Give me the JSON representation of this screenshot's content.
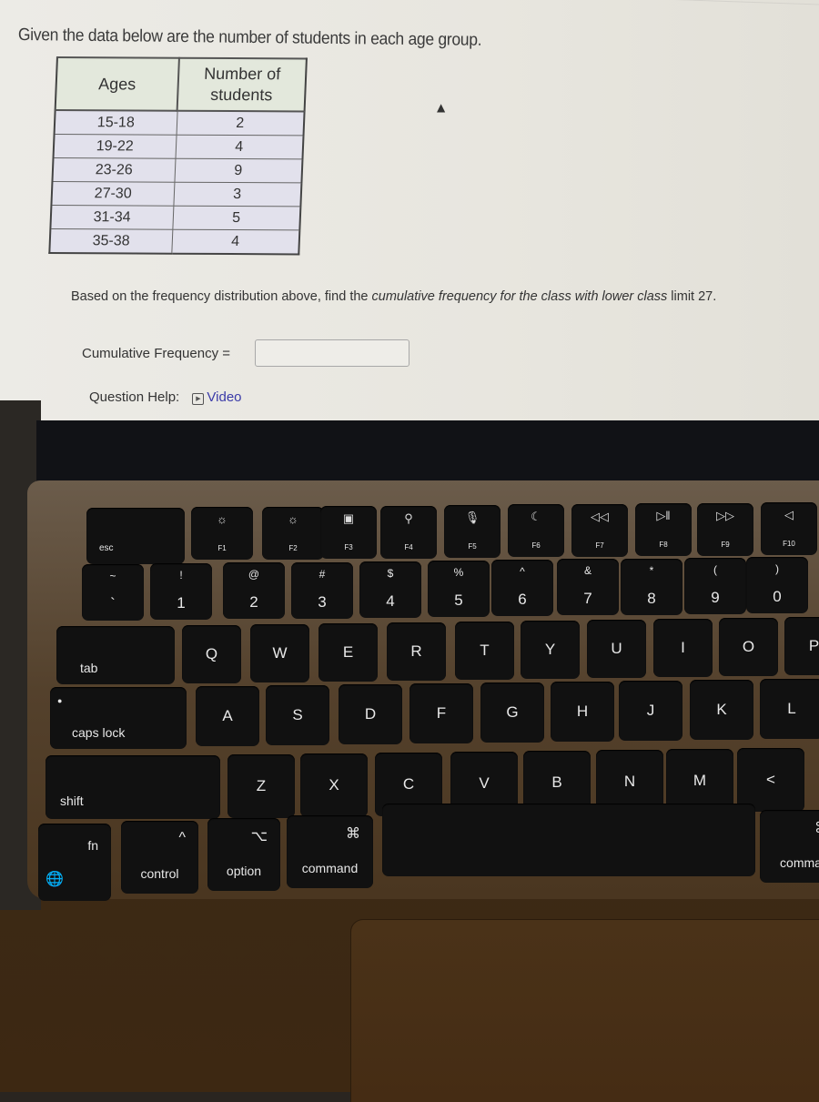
{
  "screen": {
    "title": "Given the data below are the number of students in each age group.",
    "table": {
      "headers": [
        "Ages",
        "Number of students"
      ],
      "rows": [
        {
          "ages": "15-18",
          "count": "2"
        },
        {
          "ages": "19-22",
          "count": "4"
        },
        {
          "ages": "23-26",
          "count": "9"
        },
        {
          "ages": "27-30",
          "count": "3"
        },
        {
          "ages": "31-34",
          "count": "5"
        },
        {
          "ages": "35-38",
          "count": "4"
        }
      ]
    },
    "question_pre": "Based on the frequency distribution above, find the ",
    "question_em": "cumulative frequency for the class with lower class",
    "question_post": " limit 27.",
    "answer_label": "Cumulative Frequency =",
    "answer_value": "",
    "help_label": "Question Help:",
    "help_link": "Video",
    "colors": {
      "link": "#3a3aa8",
      "table_header_bg": "#e3e8dc",
      "table_row_bg": "#e2e1ec"
    }
  },
  "keyboard": {
    "fn_row": [
      {
        "sym": "",
        "label": "esc"
      },
      {
        "sym": "☼",
        "label": "F1"
      },
      {
        "sym": "☼",
        "label": "F2"
      },
      {
        "sym": "▣",
        "label": "F3"
      },
      {
        "sym": "⚲",
        "label": "F4"
      },
      {
        "sym": "🎙",
        "label": "F5"
      },
      {
        "sym": "☾",
        "label": "F6"
      },
      {
        "sym": "◁◁",
        "label": "F7"
      },
      {
        "sym": "▷‖",
        "label": "F8"
      },
      {
        "sym": "▷▷",
        "label": "F9"
      },
      {
        "sym": "◁",
        "label": "F10"
      }
    ],
    "number_row": [
      {
        "top": "~",
        "bot": "`"
      },
      {
        "top": "!",
        "bot": "1"
      },
      {
        "top": "@",
        "bot": "2"
      },
      {
        "top": "#",
        "bot": "3"
      },
      {
        "top": "$",
        "bot": "4"
      },
      {
        "top": "%",
        "bot": "5"
      },
      {
        "top": "^",
        "bot": "6"
      },
      {
        "top": "&",
        "bot": "7"
      },
      {
        "top": "*",
        "bot": "8"
      },
      {
        "top": "(",
        "bot": "9"
      },
      {
        "top": ")",
        "bot": "0"
      }
    ],
    "qwerty_row": [
      "tab",
      "Q",
      "W",
      "E",
      "R",
      "T",
      "Y",
      "U",
      "I",
      "O",
      "P"
    ],
    "home_row": [
      "caps lock",
      "A",
      "S",
      "D",
      "F",
      "G",
      "H",
      "J",
      "K",
      "L"
    ],
    "bottom_letter_row": [
      "shift",
      "Z",
      "X",
      "C",
      "V",
      "B",
      "N",
      "M",
      "<"
    ],
    "mod_row": [
      {
        "sym": "🌐",
        "label": "fn"
      },
      {
        "sym": "^",
        "label": "control"
      },
      {
        "sym": "⌥",
        "label": "option"
      },
      {
        "sym": "⌘",
        "label": "command"
      },
      {
        "sym": "",
        "label": ""
      },
      {
        "sym": "⌘",
        "label": "comma"
      }
    ]
  }
}
